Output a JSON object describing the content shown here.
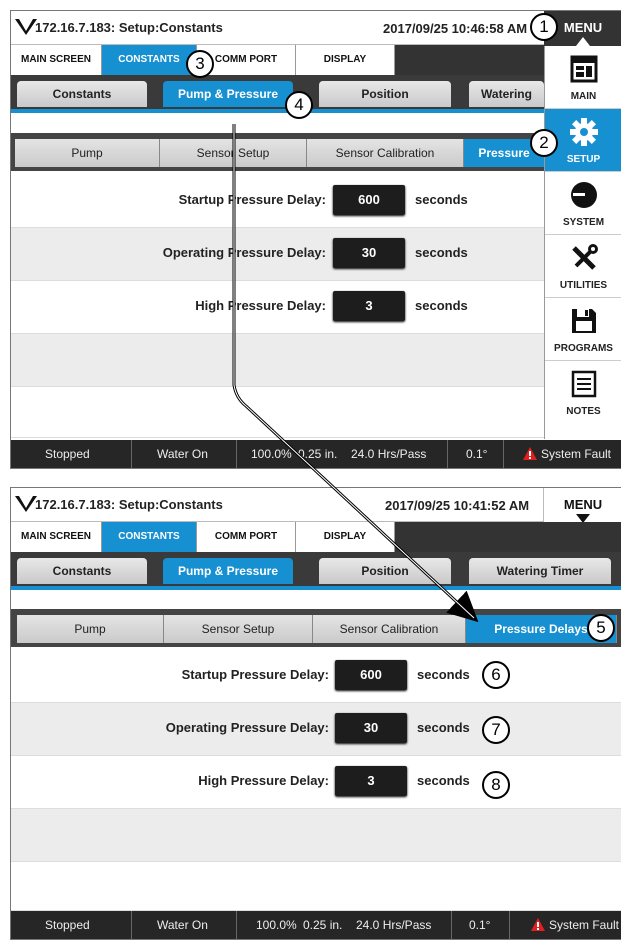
{
  "top": {
    "title": "172.16.7.183: Setup:Constants",
    "datetime": "2017/09/25 10:46:58 AM",
    "menu_label": "MENU",
    "main_tabs": [
      "MAIN SCREEN",
      "CONSTANTS",
      "COMM PORT",
      "DISPLAY"
    ],
    "sub_tabs": [
      "Constants",
      "Pump & Pressure",
      "Position",
      "Watering"
    ],
    "subsub_tabs": [
      "Pump",
      "Sensor Setup",
      "Sensor Calibration",
      "Pressure"
    ],
    "rows": [
      {
        "label": "Startup Pressure Delay:",
        "value": "600",
        "unit": "seconds"
      },
      {
        "label": "Operating Pressure Delay:",
        "value": "30",
        "unit": "seconds"
      },
      {
        "label": "High Pressure Delay:",
        "value": "3",
        "unit": "seconds"
      }
    ],
    "sidebar": [
      "MAIN",
      "SETUP",
      "SYSTEM",
      "UTILITIES",
      "PROGRAMS",
      "NOTES"
    ],
    "status": [
      "Stopped",
      "Water On",
      "100.0%",
      "0.25 in.",
      "24.0 Hrs/Pass",
      "0.1°",
      "System Fault"
    ]
  },
  "bottom": {
    "title": "172.16.7.183: Setup:Constants",
    "datetime": "2017/09/25 10:41:52 AM",
    "menu_label": "MENU",
    "main_tabs": [
      "MAIN SCREEN",
      "CONSTANTS",
      "COMM PORT",
      "DISPLAY"
    ],
    "sub_tabs": [
      "Constants",
      "Pump & Pressure",
      "Position",
      "Watering Timer"
    ],
    "subsub_tabs": [
      "Pump",
      "Sensor Setup",
      "Sensor Calibration",
      "Pressure Delays"
    ],
    "rows": [
      {
        "label": "Startup Pressure Delay:",
        "value": "600",
        "unit": "seconds"
      },
      {
        "label": "Operating Pressure Delay:",
        "value": "30",
        "unit": "seconds"
      },
      {
        "label": "High Pressure Delay:",
        "value": "3",
        "unit": "seconds"
      }
    ],
    "status": [
      "Stopped",
      "Water On",
      "100.0%",
      "0.25 in.",
      "24.0 Hrs/Pass",
      "0.1°",
      "System Fault"
    ]
  },
  "callouts": [
    "1",
    "2",
    "3",
    "4",
    "5",
    "6",
    "7",
    "8"
  ],
  "colors": {
    "accent": "#1790d2",
    "statusbar": "#262626",
    "fault": "#e02020"
  },
  "icons": {
    "sidebar": [
      "main-screen-icon",
      "gear-icon",
      "system-icon",
      "tools-icon",
      "floppy-disk-icon",
      "notes-icon"
    ],
    "logo": "valley-logo-icon",
    "fault": "warning-icon"
  }
}
